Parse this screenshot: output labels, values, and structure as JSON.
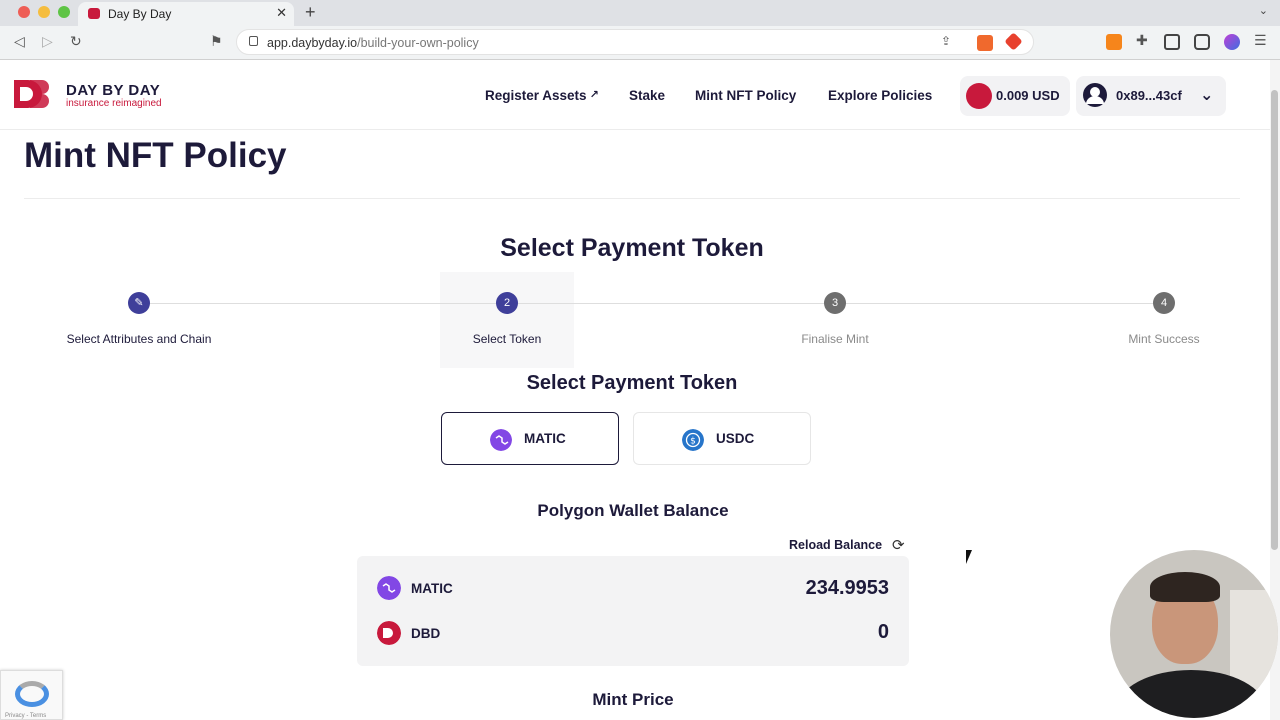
{
  "browser": {
    "tab_title": "Day By Day",
    "url_host": "app.daybyday.io",
    "url_path": "/build-your-own-policy"
  },
  "header": {
    "logo_text": "DAY BY DAY",
    "logo_subtitle": "insurance reimagined",
    "nav": {
      "register_assets": "Register Assets",
      "stake": "Stake",
      "mint_nft_policy": "Mint NFT Policy",
      "explore_policies": "Explore Policies"
    },
    "balance_pill": "0.009 USD",
    "wallet_address": "0x89...43cf"
  },
  "page": {
    "title": "Mint NFT Policy",
    "section_title": "Select Payment Token",
    "stepper": [
      {
        "number": "",
        "label": "Select Attributes and Chain",
        "state": "done"
      },
      {
        "number": "2",
        "label": "Select Token",
        "state": "active"
      },
      {
        "number": "3",
        "label": "Finalise Mint",
        "state": "pending"
      },
      {
        "number": "4",
        "label": "Mint Success",
        "state": "pending"
      }
    ],
    "token_heading": "Select Payment Token",
    "tokens": [
      {
        "label": "MATIC",
        "selected": true
      },
      {
        "label": "USDC",
        "selected": false
      }
    ],
    "wallet_heading": "Polygon Wallet Balance",
    "reload_label": "Reload Balance",
    "balances": [
      {
        "name": "MATIC",
        "value": "234.9953"
      },
      {
        "name": "DBD",
        "value": "0"
      }
    ],
    "mint_price_heading": "Mint Price"
  },
  "recaptcha": {
    "footer": "Privacy - Terms"
  },
  "colors": {
    "brand_red": "#c8193c",
    "navy": "#1d1a3a",
    "step_active": "#3f3f9a",
    "step_pending": "#6e6e6e",
    "matic_purple": "#8247e5",
    "usdc_blue": "#2775ca"
  },
  "icons": {
    "step_done": "pencil-icon",
    "external": "external-link-icon",
    "reload": "refresh-icon",
    "wallet_menu": "chevron-down-icon"
  }
}
